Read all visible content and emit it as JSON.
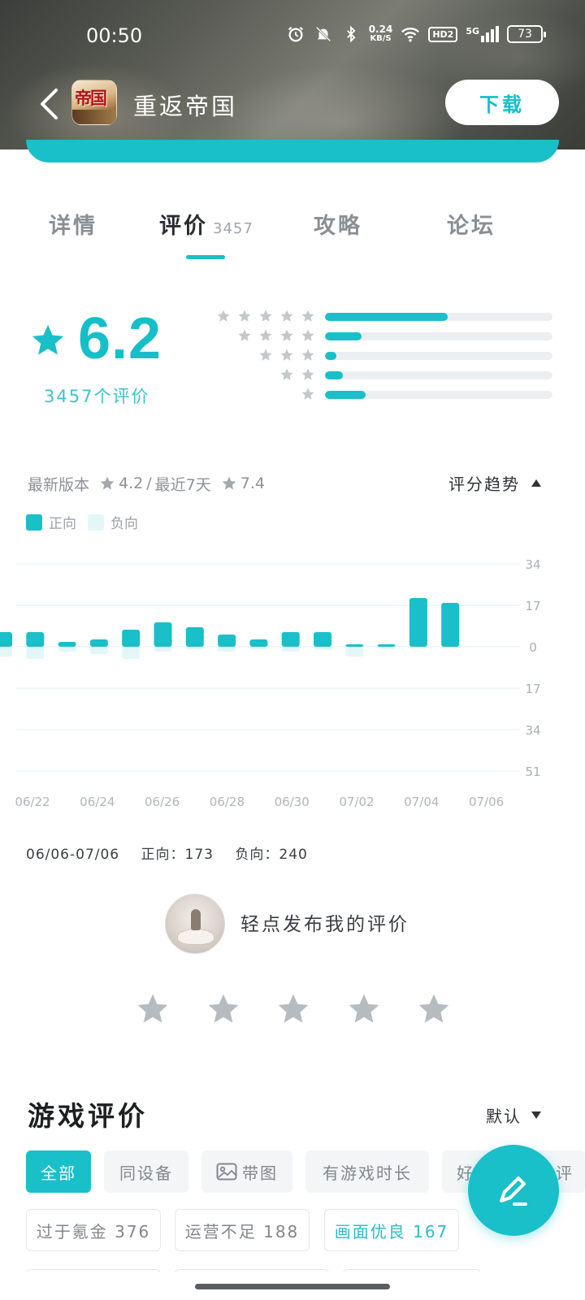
{
  "status_bar": {
    "time": "00:50",
    "net_speed_value": "0.24",
    "net_speed_unit": "KB/S",
    "hd_label": "HD2",
    "signal_label": "5G",
    "battery": "73"
  },
  "header": {
    "app_icon_text": "帝国",
    "app_title": "重返帝国",
    "download_label": "下载",
    "accent_color": "#19bfc9"
  },
  "tabs": [
    {
      "label": "详情",
      "count": ""
    },
    {
      "label": "评价",
      "count": "3457"
    },
    {
      "label": "攻略",
      "count": ""
    },
    {
      "label": "论坛",
      "count": ""
    }
  ],
  "rating": {
    "score": "6.2",
    "count_label": "3457个评价",
    "distribution": [
      {
        "stars": 5,
        "fraction": 0.54
      },
      {
        "stars": 4,
        "fraction": 0.16
      },
      {
        "stars": 3,
        "fraction": 0.05
      },
      {
        "stars": 2,
        "fraction": 0.08
      },
      {
        "stars": 1,
        "fraction": 0.18
      }
    ]
  },
  "trend": {
    "latest_version_label": "最新版本",
    "latest_version_score": "4.2",
    "recent_label": "最近7天",
    "recent_score": "7.4",
    "toggle_label": "评分趋势",
    "legend_positive": "正向",
    "legend_negative": "负向",
    "positive_color": "#19bfc9",
    "negative_color": "#e3f7f8"
  },
  "chart_data": {
    "type": "bar",
    "x": [
      "06/21",
      "06/22",
      "06/23",
      "06/24",
      "06/25",
      "06/26",
      "06/27",
      "06/28",
      "06/29",
      "06/30",
      "07/01",
      "07/02",
      "07/03",
      "07/04",
      "07/05"
    ],
    "x_tick_labels": [
      "06/22",
      "06/24",
      "06/26",
      "06/28",
      "06/30",
      "07/02",
      "07/04",
      "07/06"
    ],
    "y_tick_labels": [
      "34",
      "17",
      "0",
      "17",
      "34",
      "51"
    ],
    "ylim": [
      -51,
      34
    ],
    "series": [
      {
        "name": "正向",
        "values": [
          6,
          6,
          2,
          3,
          7,
          10,
          8,
          5,
          3,
          6,
          6,
          1,
          1,
          20,
          18
        ]
      },
      {
        "name": "负向",
        "values": [
          -4,
          -5,
          -2,
          -3,
          -5,
          -2,
          -1,
          -2,
          -1,
          -2,
          -1,
          -4,
          -1,
          0,
          0
        ]
      }
    ],
    "grid": true
  },
  "range_summary": {
    "range": "06/06-07/06",
    "positive": "正向：173",
    "negative": "负向：240"
  },
  "write_review": {
    "label": "轻点发布我的评价"
  },
  "reviews": {
    "title": "游戏评价",
    "sort_label": "默认",
    "filters_row1": [
      {
        "label": "全部",
        "active": true
      },
      {
        "label": "同设备",
        "active": false
      },
      {
        "label": "带图",
        "active": false
      },
      {
        "label": "有游戏时长",
        "active": false
      },
      {
        "label": "好",
        "active": false
      }
    ],
    "filters_row1_tail": "评",
    "filters_row2": [
      {
        "label": "过于氪金 376"
      },
      {
        "label": "运营不足 188"
      },
      {
        "label": "画面优良 167"
      }
    ]
  }
}
